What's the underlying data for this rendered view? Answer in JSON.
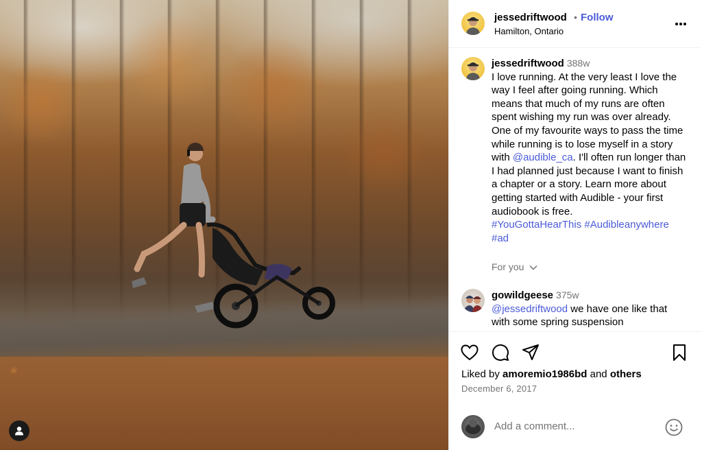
{
  "post": {
    "username": "jessedriftwood",
    "follow_label": "Follow",
    "separator": "•",
    "location": "Hamilton, Ontario",
    "more_label": "•••"
  },
  "caption": {
    "username": "jessedriftwood",
    "time": "388w",
    "text_1": "I love running. At the very least I love the way I feel after going running. Which means that much of my runs are often spent wishing my run was over already. One of my favourite ways to pass the time while running is to lose myself in a story with ",
    "mention": "@audible_ca",
    "text_2": ". I'll often run longer than I had planned just because I want to finish a chapter or a story. Learn more about getting started with Audible - your first audiobook is free.",
    "hashtag_1": "#YouGottaHearThis",
    "hashtag_2": "#Audibleanywhere",
    "hashtag_3": "#ad"
  },
  "for_you": "For you",
  "comment": {
    "username": "gowildgeese",
    "time": "375w",
    "mention": "@jessedriftwood",
    "text": " we have one like that with some spring suspension"
  },
  "likes": {
    "prefix": "Liked by ",
    "user": "amoremio1986bd",
    "middle": " and ",
    "others": "others"
  },
  "date": "December 6, 2017",
  "add_comment": {
    "placeholder": "Add a comment..."
  },
  "icons": {
    "like": "heart-icon",
    "comment": "comment-icon",
    "share": "send-icon",
    "save": "bookmark-icon",
    "more": "more-icon",
    "emoji": "emoji-icon",
    "photo_user": "user-icon"
  },
  "colors": {
    "link": "#4a5ad8",
    "muted": "#737373",
    "divider": "#efefef"
  }
}
